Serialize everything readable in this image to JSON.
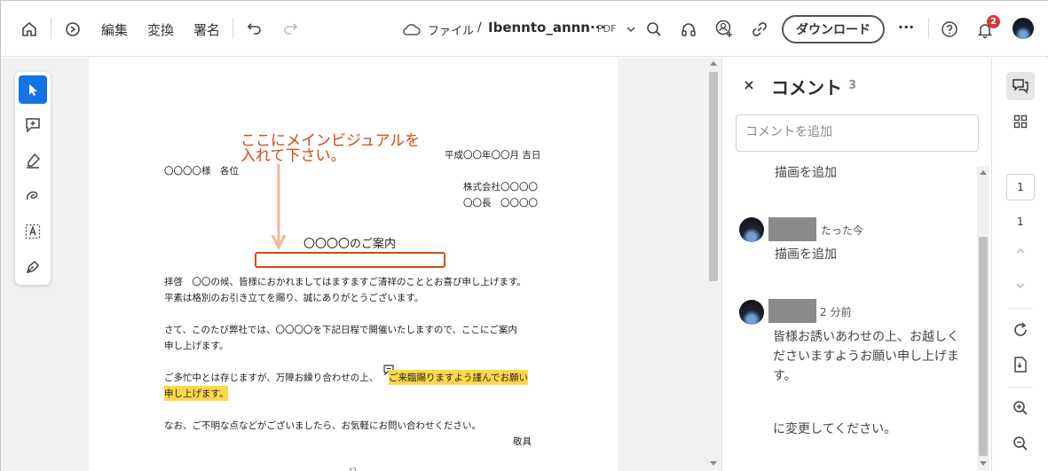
{
  "toolbar": {
    "menu_edit": "編集",
    "menu_convert": "変換",
    "menu_sign": "署名",
    "breadcrumb_files": "ファイル",
    "breadcrumb_sep": "/",
    "filename": "Ibennto_annn···",
    "filetype": "PDF",
    "download_label": "ダウンロード",
    "more": "···",
    "notification_count": "2"
  },
  "document": {
    "annotation_line1": "ここにメインビジュアルを",
    "annotation_line2": "入れて下さい。",
    "date": "平成〇〇年〇〇月 吉日",
    "recipient": "〇〇〇〇様　各位",
    "company": "株式会社〇〇〇〇",
    "sender": "〇〇長　〇〇〇〇",
    "heading": "〇〇〇〇のご案内",
    "p1_line1": "拝啓　〇〇の候、皆様におかれましてはますますご清祥のこととお喜び申し上げます。",
    "p1_line2": "平素は格別のお引き立てを賜り、誠にありがとうございます。",
    "p2_line1": "さて、このたび弊社では、〇〇〇〇を下記日程で開催いたしますので、ここにご案内",
    "p2_line2": "申し上げます。",
    "p3_line1_plain": "ご多忙中とは存じますが、万障お繰り合わせの上、",
    "p3_line1_hl": "ご来臨賜りますよう謹んでお願い",
    "p3_line2_hl": "申し上げます。",
    "p4_line1": "なお、ご不明な点などがございましたら、お気軽にお問い合わせください。",
    "closing": "敬具",
    "footer_partial": "記",
    "annotation_color": "#d24a12",
    "highlight_color": "#ffd84a"
  },
  "comments_panel": {
    "title": "コメント",
    "count": "3",
    "input_placeholder": "コメントを追加",
    "items": [
      {
        "time": "",
        "lines": [
          "描画を追加"
        ]
      },
      {
        "time": "たった今",
        "lines": [
          "描画を追加"
        ]
      },
      {
        "time": "2 分前",
        "lines": [
          "皆様お誘いあわせの上、お越しく",
          "ださいますようお願い申し上げま",
          "す。",
          "",
          "に変更してください。"
        ]
      }
    ]
  },
  "right_rail": {
    "page_input": "1",
    "total_pages": "1"
  },
  "colors": {
    "accent": "#1473e6",
    "badge": "#d7373f"
  }
}
